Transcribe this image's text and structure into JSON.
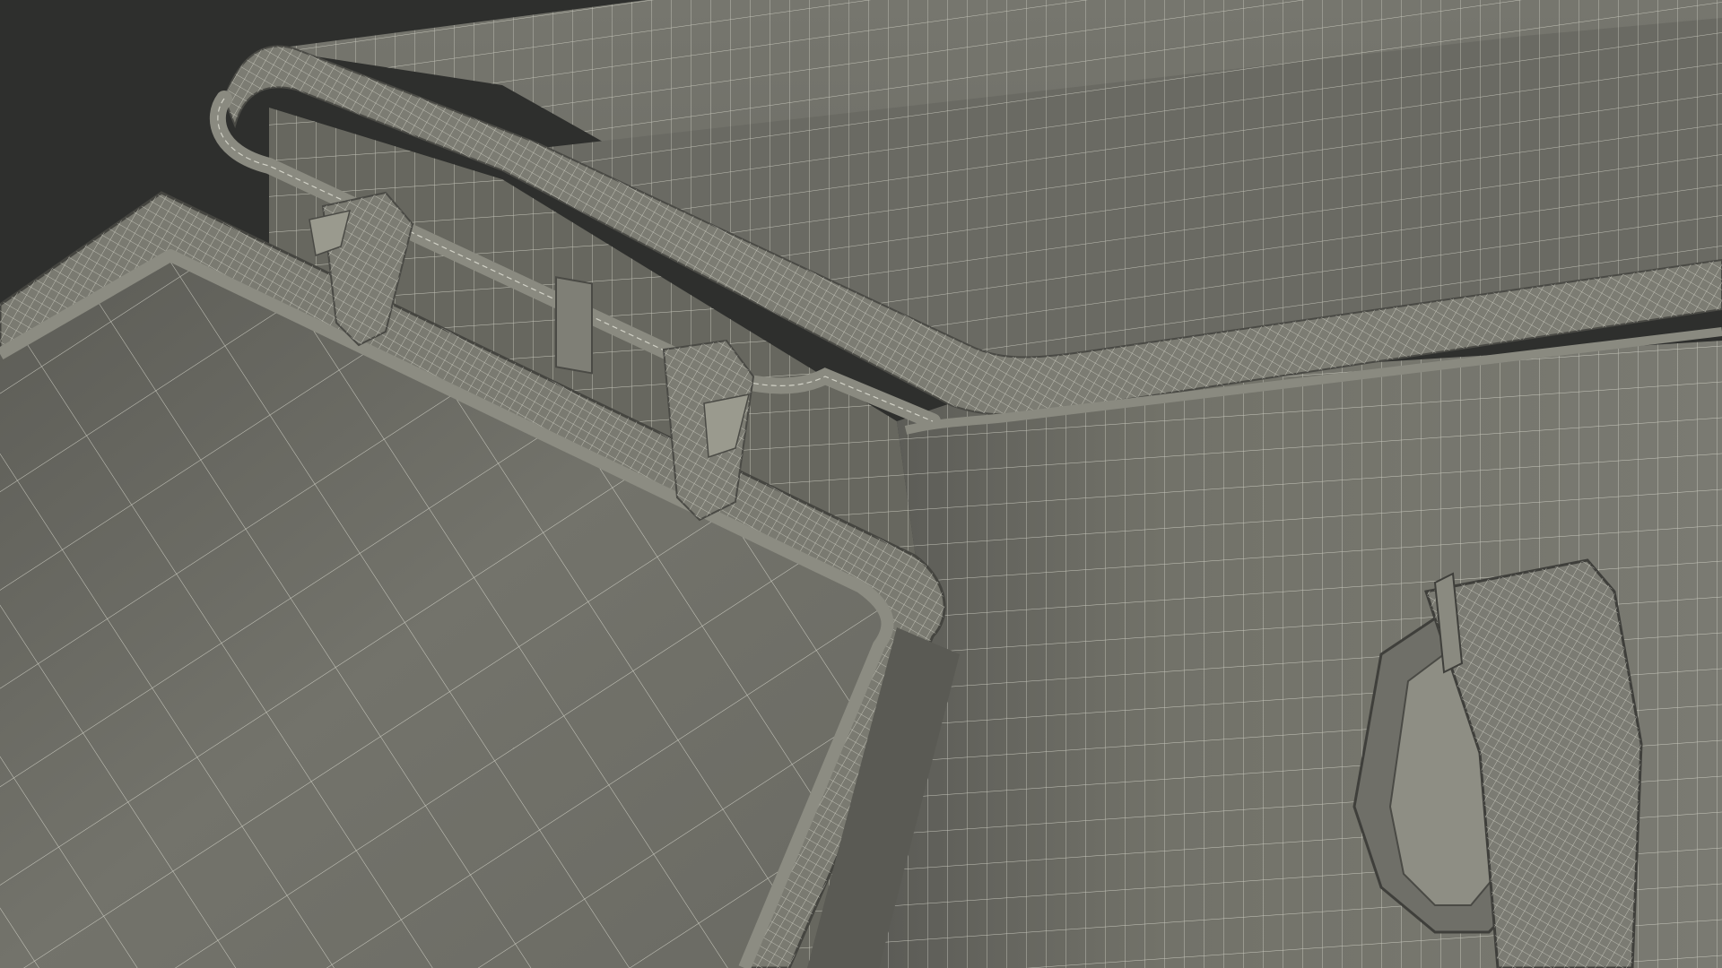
{
  "scene": {
    "subject": "wireframe-render-open-case",
    "colors": {
      "background": "#2e2f2d",
      "surface": "#6f6f68",
      "surface_dark": "#5f5f59",
      "surface_light": "#7b7b73",
      "rim": "#858579",
      "wire": "#e4e4d8"
    }
  }
}
